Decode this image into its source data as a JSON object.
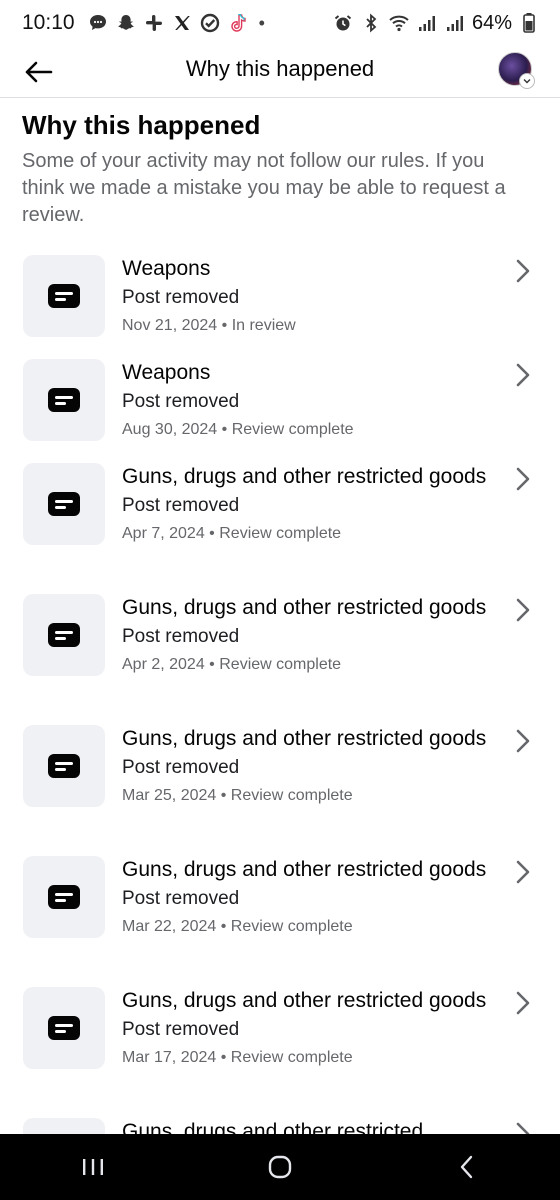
{
  "status_bar": {
    "time": "10:10",
    "dot": "•",
    "battery_percent": "64%",
    "left_icons": [
      "chat-icon",
      "snapchat-icon",
      "slack-icon",
      "x-icon",
      "checkmark-icon",
      "tiktok-icon"
    ],
    "right_icons": [
      "alarm-icon",
      "bluetooth-icon",
      "wifi-icon",
      "signal-icon",
      "signal-icon",
      "battery-icon"
    ]
  },
  "header": {
    "title": "Why this happened",
    "back_icon": "arrow-left-icon",
    "avatar_badge_icon": "chevron-down-icon"
  },
  "page": {
    "title": "Why this happened",
    "description": "Some of your activity may not follow our rules. If you think we made a mistake you may be able to request a review."
  },
  "items": [
    {
      "title": "Weapons",
      "subtitle": "Post removed",
      "date": "Nov 21, 2024",
      "status": "In review"
    },
    {
      "title": "Weapons",
      "subtitle": "Post removed",
      "date": "Aug 30, 2024",
      "status": "Review complete"
    },
    {
      "title": "Guns, drugs and other restricted goods",
      "subtitle": "Post removed",
      "date": "Apr 7, 2024",
      "status": "Review complete"
    },
    {
      "title": "Guns, drugs and other restricted goods",
      "subtitle": "Post removed",
      "date": "Apr 2, 2024",
      "status": "Review complete"
    },
    {
      "title": "Guns, drugs and other restricted goods",
      "subtitle": "Post removed",
      "date": "Mar 25, 2024",
      "status": "Review complete"
    },
    {
      "title": "Guns, drugs and other restricted goods",
      "subtitle": "Post removed",
      "date": "Mar 22, 2024",
      "status": "Review complete"
    },
    {
      "title": "Guns, drugs and other restricted goods",
      "subtitle": "Post removed",
      "date": "Mar 17, 2024",
      "status": "Review complete"
    },
    {
      "title": "Guns, drugs and other restricted",
      "subtitle": "",
      "date": "",
      "status": ""
    }
  ],
  "separator": " • ",
  "nav_bar": {
    "icons": [
      "recent-apps-icon",
      "home-icon",
      "back-icon"
    ]
  },
  "colors": {
    "text_primary": "#050505",
    "text_secondary": "#65676b",
    "icon_box_bg": "#f0f1f4",
    "nav_bar_bg": "#000000"
  }
}
